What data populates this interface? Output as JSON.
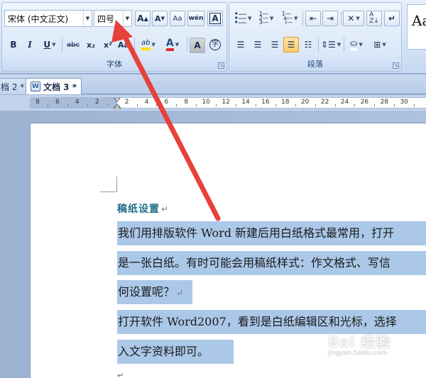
{
  "ribbon": {
    "font_group": {
      "label": "字体",
      "font_name": "宋体 (中文正文)",
      "font_size": "四号",
      "grow_font_icon": "A",
      "shrink_font_icon": "A",
      "clear_format_icon": "Aa",
      "phonetic_icon": "wén",
      "border_char_icon": "A",
      "bold": "B",
      "italic": "I",
      "underline": "U",
      "strikethrough": "abc",
      "subscript": "x₂",
      "superscript": "x²",
      "change_case": "Aa",
      "highlight": "ab",
      "font_color": "A",
      "char_shading": "A",
      "enclose_char": "字"
    },
    "paragraph_group": {
      "label": "段落"
    },
    "styles_preview": "Aa"
  },
  "tabs": [
    {
      "label": "档 2 *"
    },
    {
      "label": "文档 3 *"
    }
  ],
  "ruler": {
    "labels": [
      "8",
      "6",
      "4",
      "2",
      "2",
      "4",
      "6",
      "8",
      "10",
      "12",
      "14",
      "16",
      "18",
      "20",
      "22",
      "24",
      "26",
      "28",
      "30"
    ]
  },
  "document": {
    "title": "稿纸设置",
    "lines": [
      "我们用排版软件 Word 新建后用白纸格式最常用，打开",
      "是一张白纸。有时可能会用稿纸样式：作文格式、写信",
      "何设置呢？",
      "打开软件 Word2007，看到是白纸编辑区和光标，选择",
      "入文字资料即可。"
    ],
    "paragraph_mark": "↵"
  },
  "watermark": {
    "main": "Bai 经验",
    "sub": "jingyan.baidu.com"
  },
  "colors": {
    "arrow": "#e8403a",
    "selection": "#abc8e8",
    "title_color": "#1f6e8a"
  }
}
